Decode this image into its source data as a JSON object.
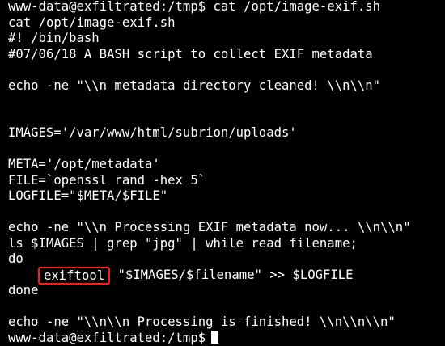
{
  "terminal": {
    "prompt": "www-data@exfiltrated:/tmp$",
    "command": "cat /opt/image-exif.sh",
    "lines": [
      "cat /opt/image-exif.sh",
      "#! /bin/bash",
      "#07/06/18 A BASH script to collect EXIF metadata",
      "",
      "echo -ne \"\\\\n metadata directory cleaned! \\\\n\\\\n\"",
      "",
      "",
      "IMAGES='/var/www/html/subrion/uploads'",
      "",
      "META='/opt/metadata'",
      "FILE=`openssl rand -hex 5`",
      "LOGFILE=\"$META/$FILE\"",
      "",
      "echo -ne \"\\\\n Processing EXIF metadata now... \\\\n\\\\n\"",
      "ls $IMAGES | grep \"jpg\" | while read filename;",
      "do"
    ],
    "highlighted_command": "exiftool",
    "highlighted_rest": " \"$IMAGES/$filename\" >> $LOGFILE",
    "after_lines": [
      "done",
      "",
      "echo -ne \"\\\\n\\\\n Processing is finished! \\\\n\\\\n\\\\n\""
    ],
    "final_prompt": "www-data@exfiltrated:/tmp$",
    "highlight_color": "#ff1a1a"
  }
}
